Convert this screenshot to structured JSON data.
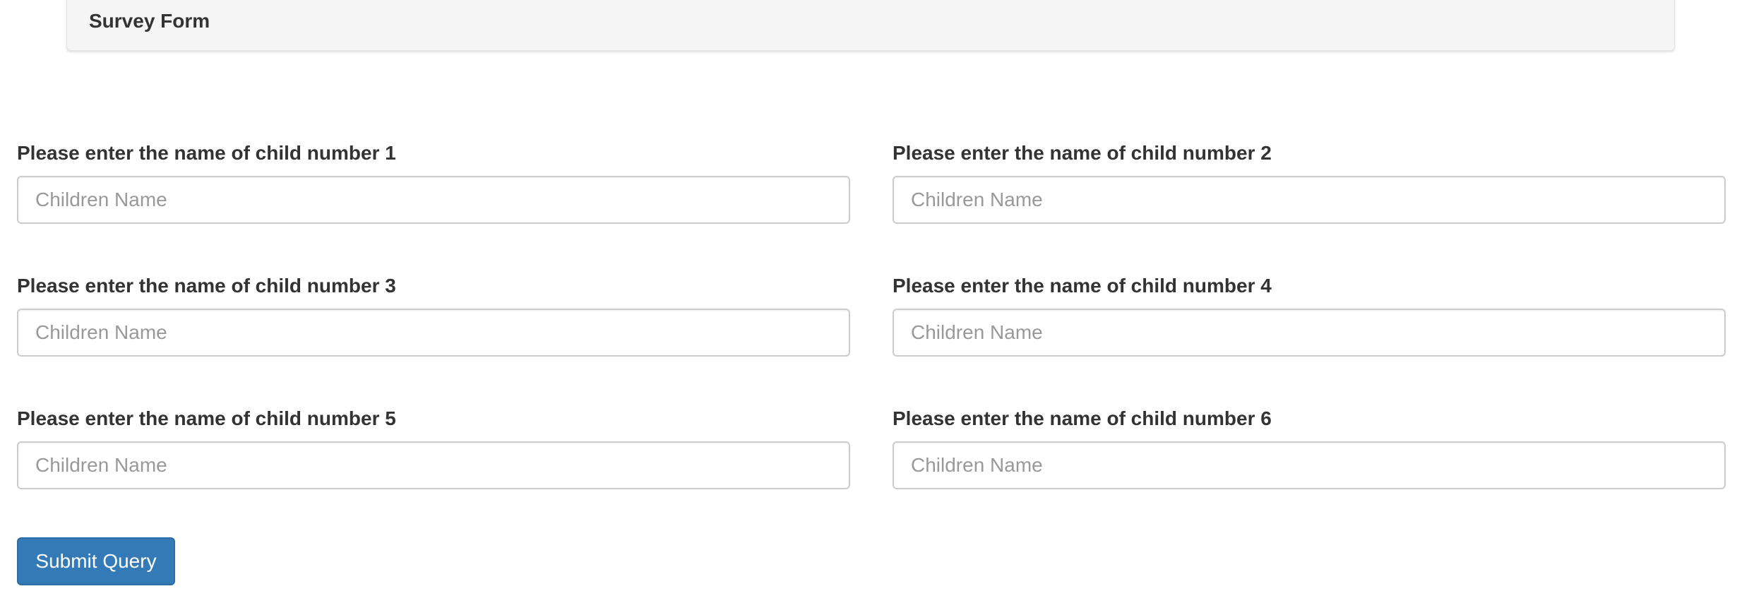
{
  "header": {
    "title": "Survey Form"
  },
  "form": {
    "fields": [
      {
        "label": "Please enter the name of child number 1",
        "placeholder": "Children Name",
        "value": ""
      },
      {
        "label": "Please enter the name of child number 2",
        "placeholder": "Children Name",
        "value": ""
      },
      {
        "label": "Please enter the name of child number 3",
        "placeholder": "Children Name",
        "value": ""
      },
      {
        "label": "Please enter the name of child number 4",
        "placeholder": "Children Name",
        "value": ""
      },
      {
        "label": "Please enter the name of child number 5",
        "placeholder": "Children Name",
        "value": ""
      },
      {
        "label": "Please enter the name of child number 6",
        "placeholder": "Children Name",
        "value": ""
      }
    ],
    "submit_label": "Submit Query"
  },
  "colors": {
    "header_bg": "#f5f5f5",
    "text": "#333333",
    "placeholder": "#999999",
    "input_border": "#cccccc",
    "button_bg": "#337ab7",
    "button_border": "#2e6da4",
    "button_text": "#ffffff"
  }
}
